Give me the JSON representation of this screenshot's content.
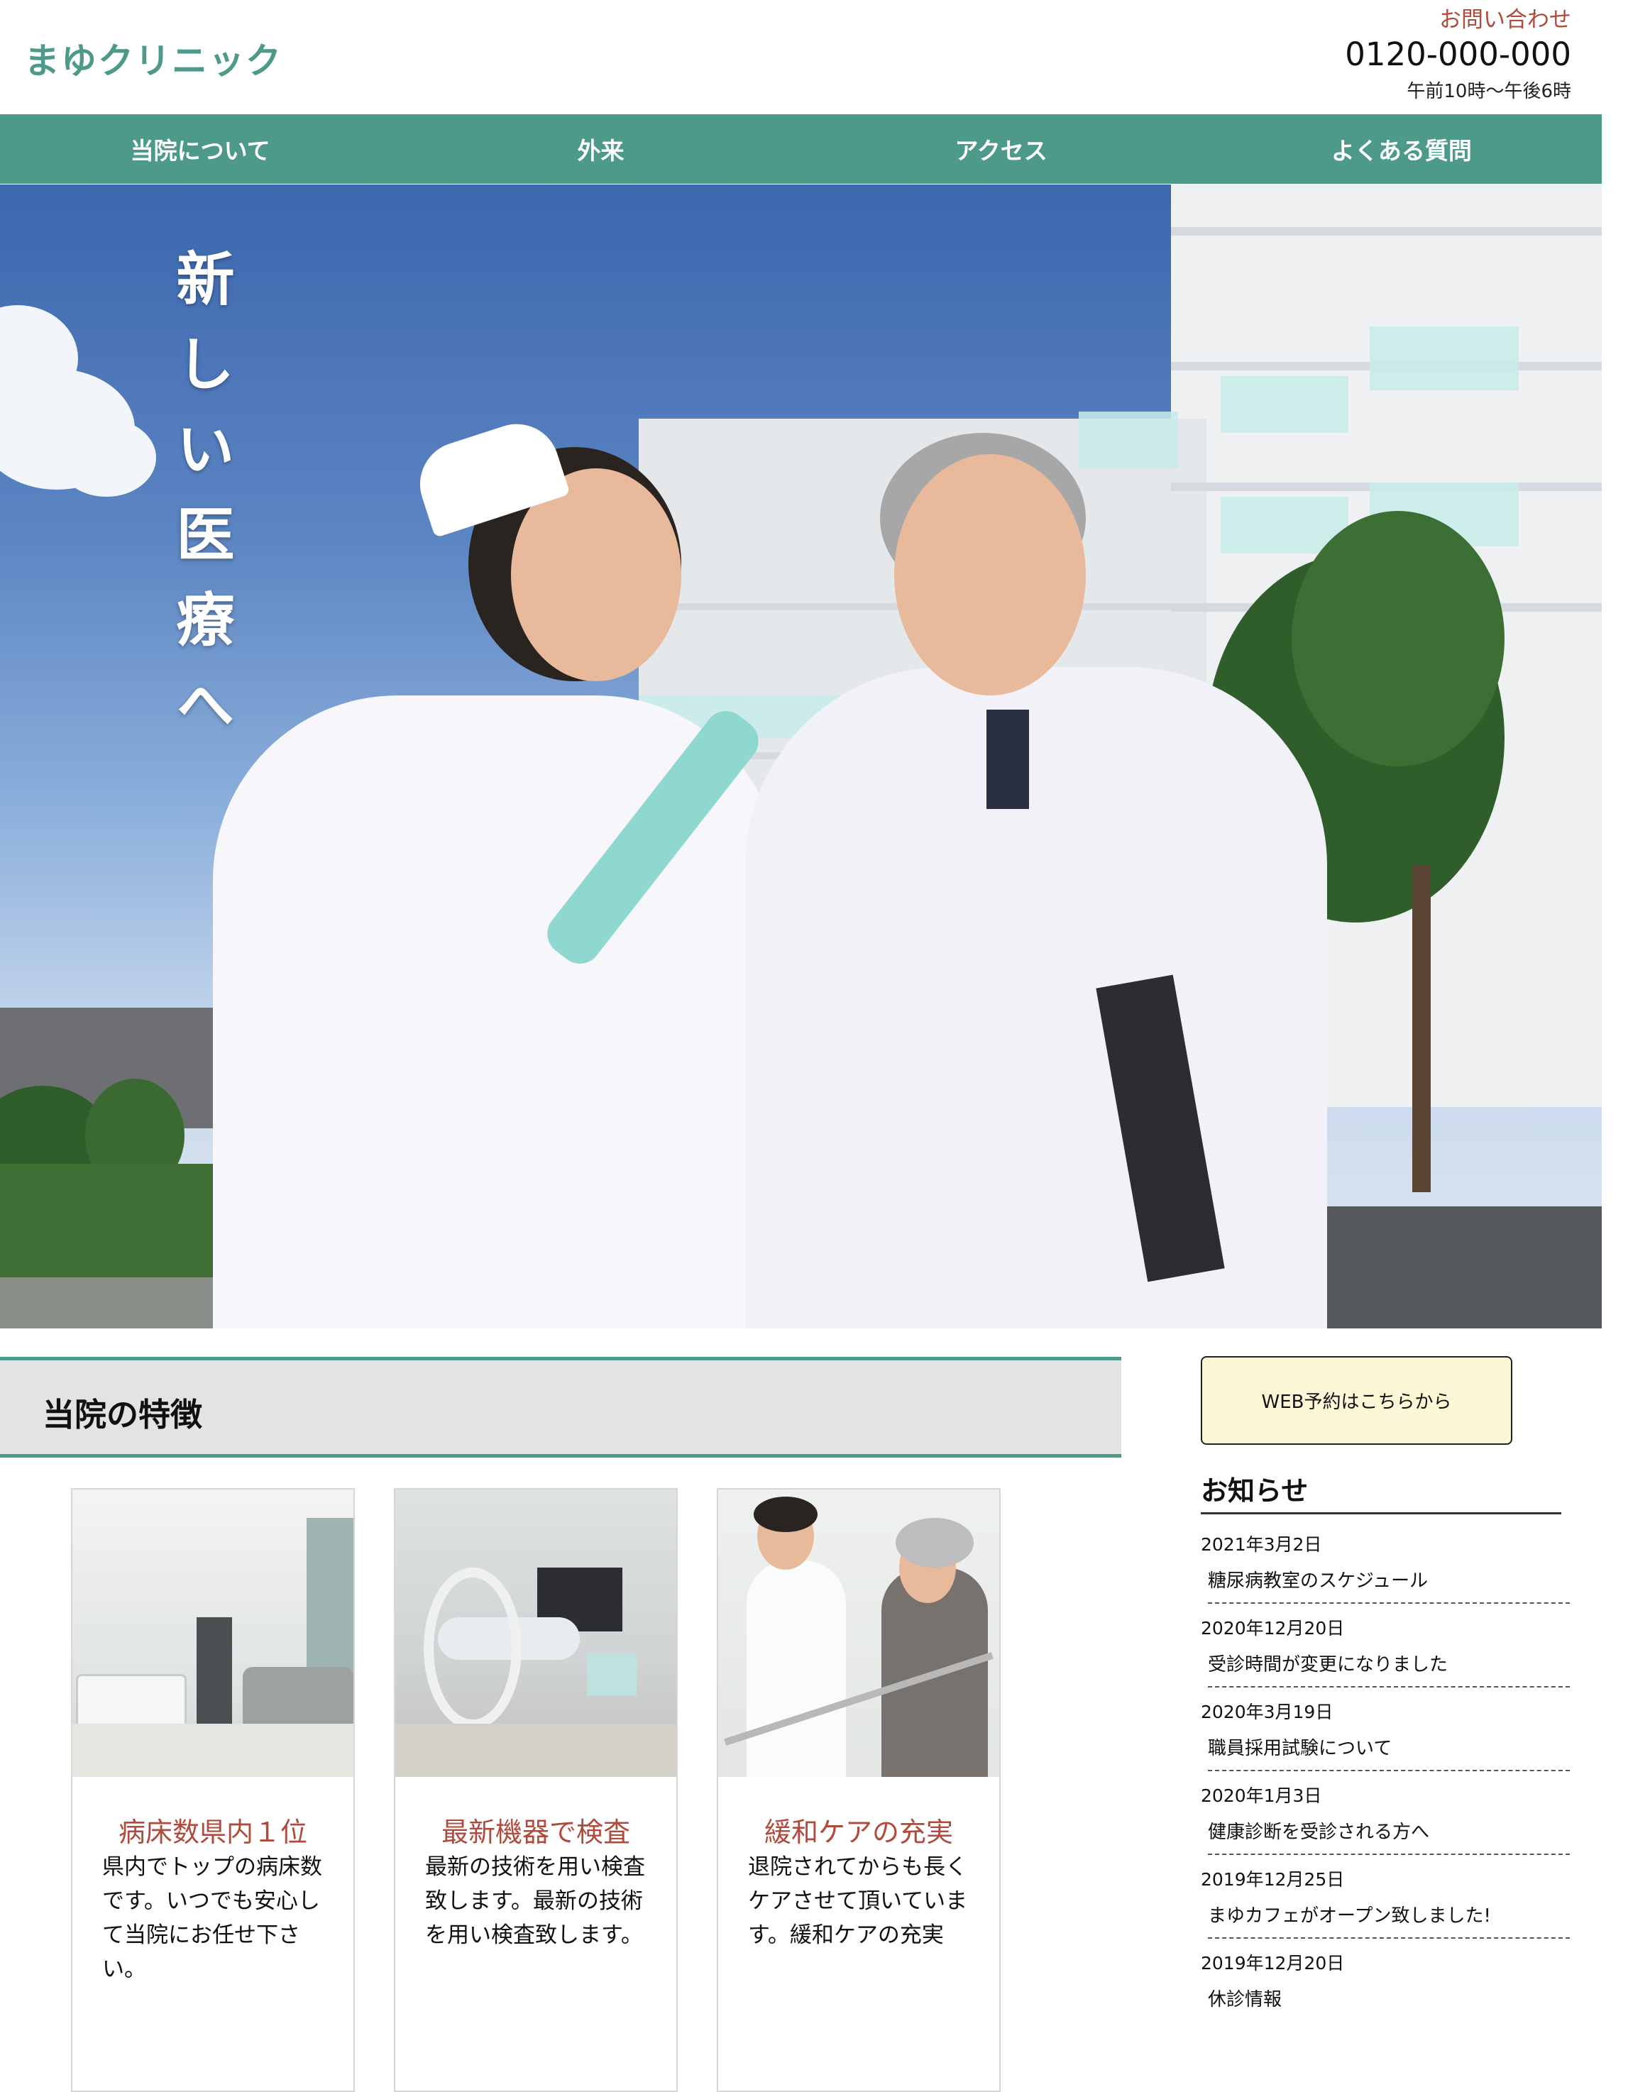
{
  "header": {
    "logo": "まゆクリニック",
    "contact_label": "お問い合わせ",
    "phone": "0120-000-000",
    "hours": "午前10時〜午後6時"
  },
  "nav": {
    "items": [
      {
        "label": "当院について"
      },
      {
        "label": "外来"
      },
      {
        "label": "アクセス"
      },
      {
        "label": "よくある質問"
      }
    ]
  },
  "hero": {
    "tagline": "新しい医療へ"
  },
  "features": {
    "title": "当院の特徴",
    "cards": [
      {
        "title": "病床数県内１位",
        "text": "県内でトップの病床数です。いつでも安心して当院にお任せ下さい。"
      },
      {
        "title": "最新機器で検査",
        "text": "最新の技術を用い検査致します。最新の技術を用い検査致します。"
      },
      {
        "title": "緩和ケアの充実",
        "text": "退院されてからも長くケアさせて頂いています。緩和ケアの充実"
      }
    ]
  },
  "sidebar": {
    "web_button": "WEB予約はこちらから",
    "news_title": "お知らせ",
    "news": [
      {
        "date": "2021年3月2日",
        "text": "糖尿病教室のスケジュール"
      },
      {
        "date": "2020年12月20日",
        "text": "受診時間が変更になりました"
      },
      {
        "date": "2020年3月19日",
        "text": "職員採用試験について"
      },
      {
        "date": "2020年1月3日",
        "text": "健康診断を受診される方へ"
      },
      {
        "date": "2019年12月25日",
        "text": "まゆカフェがオープン致しました!"
      },
      {
        "date": "2019年12月20日",
        "text": "休診情報"
      }
    ]
  },
  "colors": {
    "brand": "#4e9a8a",
    "accent_red": "#b04a3c",
    "button_bg": "#fdf6d6"
  }
}
